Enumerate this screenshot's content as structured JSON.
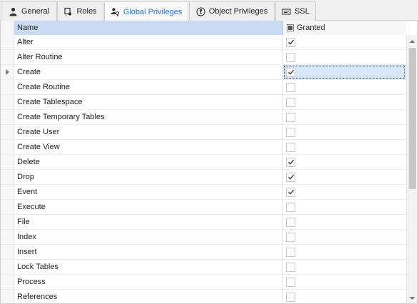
{
  "tabs": [
    {
      "label": "General",
      "icon": "user-icon"
    },
    {
      "label": "Roles",
      "icon": "roles-icon"
    },
    {
      "label": "Global Privileges",
      "icon": "users-key-icon",
      "active": true
    },
    {
      "label": "Object Privileges",
      "icon": "object-privileges-icon"
    },
    {
      "label": "SSL",
      "icon": "ssl-icon"
    }
  ],
  "grid": {
    "columns": {
      "name": "Name",
      "granted": "Granted"
    },
    "rows": [
      {
        "name": "Alter",
        "granted": true
      },
      {
        "name": "Alter Routine",
        "granted": false
      },
      {
        "name": "Create",
        "granted": true,
        "selected": true
      },
      {
        "name": "Create Routine",
        "granted": false
      },
      {
        "name": "Create Tablespace",
        "granted": false
      },
      {
        "name": "Create Temporary Tables",
        "granted": false
      },
      {
        "name": "Create User",
        "granted": false
      },
      {
        "name": "Create View",
        "granted": false
      },
      {
        "name": "Delete",
        "granted": true
      },
      {
        "name": "Drop",
        "granted": true
      },
      {
        "name": "Event",
        "granted": true
      },
      {
        "name": "Execute",
        "granted": false
      },
      {
        "name": "File",
        "granted": false
      },
      {
        "name": "Index",
        "granted": false
      },
      {
        "name": "Insert",
        "granted": false
      },
      {
        "name": "Lock Tables",
        "granted": false
      },
      {
        "name": "Process",
        "granted": false
      },
      {
        "name": "References",
        "granted": false
      }
    ]
  },
  "colors": {
    "active_tab_text": "#2a72c8",
    "header_name_bg": "#c9dbf2",
    "selection_bg": "#d7e6f8"
  }
}
